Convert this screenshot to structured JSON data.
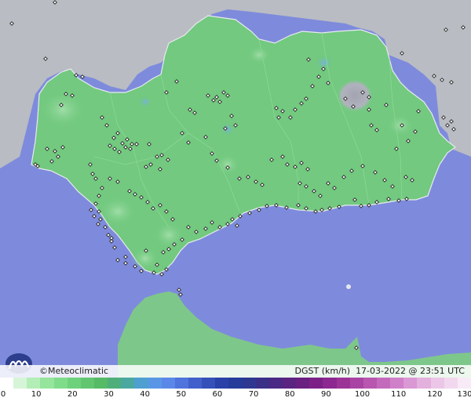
{
  "brand": {
    "copyright": "©",
    "name": "Meteoclimatic"
  },
  "info": {
    "variable": "DGST",
    "unit": "(km/h)",
    "timestamp": "17-03-2022 @ 23:51 UTC"
  },
  "colors": {
    "sea": "#7e8bdc",
    "land_other": "#b9bcc3",
    "region_fill": "#72c97f",
    "region_light": "#8fd79a",
    "border": "#e8eaef",
    "mountain_gray": "#a7a7b2",
    "station_dot": "#222222"
  },
  "scale": {
    "ticks": [
      "0",
      "10",
      "20",
      "30",
      "40",
      "50",
      "60",
      "70",
      "80",
      "90",
      "100",
      "110",
      "120",
      "130"
    ],
    "colors": [
      "#ffffff",
      "#d6f5d8",
      "#b2eeb6",
      "#95e59c",
      "#7fdc8a",
      "#6ed17c",
      "#62c670",
      "#55bb66",
      "#4faf7a",
      "#4ba8a0",
      "#4f9fd0",
      "#5a96e6",
      "#5b88e8",
      "#4f74dc",
      "#4260cc",
      "#3550b8",
      "#2a42a8",
      "#263c9a",
      "#2e3890",
      "#3a3088",
      "#4a2a84",
      "#5a2480",
      "#6a2080",
      "#7c2088",
      "#8c2890",
      "#9c3498",
      "#aa44a4",
      "#b856b0",
      "#c46abc",
      "#d080c8",
      "#da98d4",
      "#e4b0de",
      "#ecc6e6",
      "#f2d8ee",
      "#f8eaf6"
    ]
  },
  "map": {
    "stations_count": 190
  }
}
